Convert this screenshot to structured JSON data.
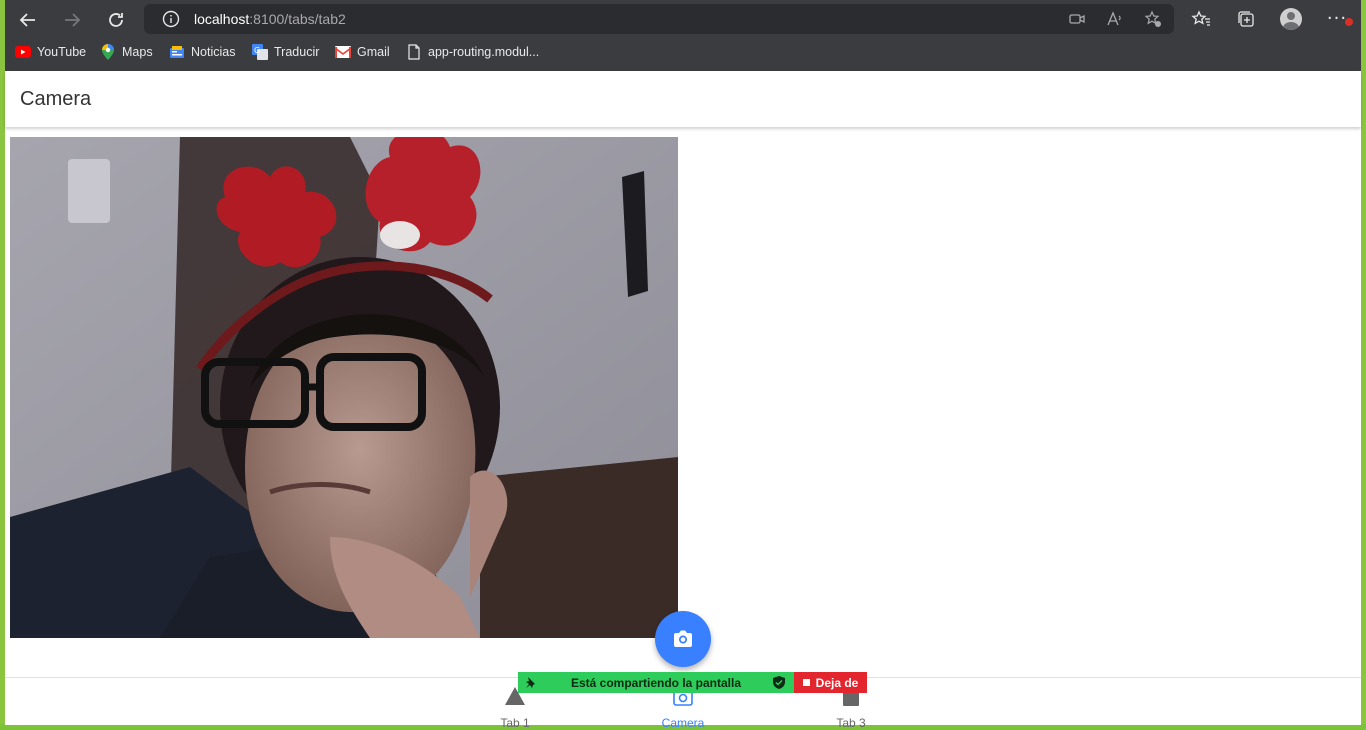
{
  "browser": {
    "url_host": "localhost",
    "url_path": ":8100/tabs/tab2",
    "bookmarks": [
      {
        "label": "YouTube",
        "icon": "youtube-icon"
      },
      {
        "label": "Maps",
        "icon": "maps-icon"
      },
      {
        "label": "Noticias",
        "icon": "news-icon"
      },
      {
        "label": "Traducir",
        "icon": "translate-icon"
      },
      {
        "label": "Gmail",
        "icon": "gmail-icon"
      },
      {
        "label": "app-routing.modul...",
        "icon": "file-icon"
      }
    ]
  },
  "app": {
    "title": "Camera",
    "photo_alt": "Foto capturada",
    "tabs": [
      {
        "label": "Tab 1",
        "icon": "triangle-icon",
        "active": false
      },
      {
        "label": "Camera",
        "icon": "camera-icon",
        "active": true
      },
      {
        "label": "Tab 3",
        "icon": "square-icon",
        "active": false
      }
    ]
  },
  "screen_share": {
    "message": "Está compartiendo la pantalla",
    "stop_label": "Deja de"
  },
  "colors": {
    "accent": "#3880ff",
    "chrome": "#3b3c40",
    "share_green": "#2ecc5b",
    "share_red": "#e3262d",
    "window_frame": "#8bc53f"
  }
}
